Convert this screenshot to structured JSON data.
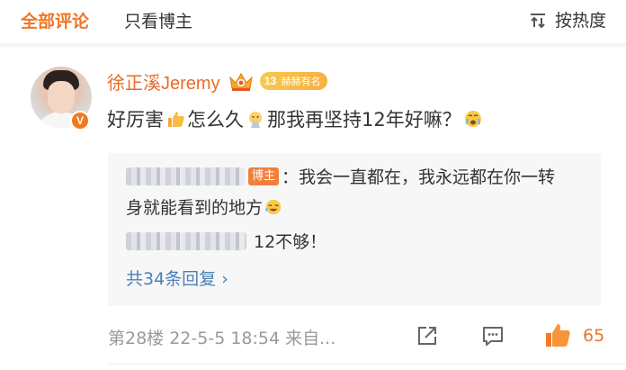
{
  "filter_bar": {
    "tab_all": "全部评论",
    "tab_author_only": "只看博主",
    "sort_label": "按热度",
    "sort_icon": "sort-arrows-icon"
  },
  "comment": {
    "username": "徐正溪Jeremy",
    "verified_badge": "V",
    "fan_badge": {
      "level": "13",
      "name": "赫赫有名"
    },
    "text_part1": "好厉害",
    "text_part2": "怎么久",
    "text_part3": "那我再坚持12年好嘛？",
    "icons": [
      "thumbs-up-emoji-icon",
      "pray-emoji-icon",
      "crying-emoji-icon"
    ]
  },
  "replies": {
    "author_tag": "博主",
    "reply1_line1": "：我会一直都在，我永远都在你一转",
    "reply1_line2": "身就能看到的地方",
    "reply2_text": "12不够！",
    "more_label": "共34条回复 ›"
  },
  "footer": {
    "meta": "第28楼  22-5-5 18:54  来自...",
    "like_count": "65",
    "icons": [
      "share-icon",
      "comment-icon",
      "like-icon"
    ]
  },
  "colors": {
    "accent_orange": "#f27424",
    "link_blue": "#4a7fb5",
    "username_orange": "#e86b2b"
  }
}
